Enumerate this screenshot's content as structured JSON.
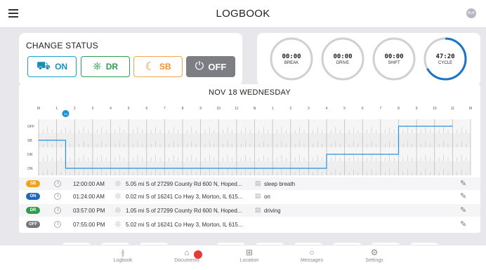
{
  "app": {
    "title": "LOGBOOK",
    "avatar_initials": "BLB"
  },
  "change_status": {
    "heading": "CHANGE STATUS",
    "buttons": [
      {
        "label": "ON",
        "icon": "truck-icon"
      },
      {
        "label": "DR",
        "icon": "steering-wheel-icon"
      },
      {
        "label": "SB",
        "icon": "sleep-icon"
      },
      {
        "label": "OFF",
        "icon": "power-icon",
        "active": true
      }
    ]
  },
  "timers": [
    {
      "value": "00:00",
      "label": "BREAK",
      "progress": 0
    },
    {
      "value": "00:00",
      "label": "DRIVE",
      "progress": 0
    },
    {
      "value": "00:00",
      "label": "SHIFT",
      "progress": 0
    },
    {
      "value": "47:20",
      "label": "CYCLE",
      "progress": 0.67
    }
  ],
  "log": {
    "date": "NOV 18 WEDNESDAY",
    "current_hour_marker": "14",
    "hour_labels": [
      "M",
      "1",
      "2",
      "3",
      "4",
      "5",
      "6",
      "7",
      "8",
      "9",
      "10",
      "11",
      "N",
      "1",
      "2",
      "3",
      "4",
      "5",
      "6",
      "7",
      "8",
      "9",
      "10",
      "11",
      "M"
    ],
    "status_rows": [
      "OFF",
      "SB",
      "DR",
      "ON"
    ],
    "graph_segments": [
      {
        "status": "SB",
        "from_hour": 0,
        "to_hour": 1.5
      },
      {
        "status": "ON",
        "from_hour": 1.5,
        "to_hour": 16.0
      },
      {
        "status": "DR",
        "from_hour": 16.0,
        "to_hour": 20.0
      },
      {
        "status": "OFF",
        "from_hour": 20.0,
        "to_hour": 23.0
      }
    ],
    "entries": [
      {
        "status": "SB",
        "color": "#f0a21a",
        "time": "12:00:00 AM",
        "location": "5.05 mi S of 27299 County Rd 600 N, Hoped...",
        "note": "sleep breath"
      },
      {
        "status": "ON",
        "color": "#1769c4",
        "time": "01:24:00 AM",
        "location": "0.02 mi S of 16241 Co Hwy 3, Morton, IL 615...",
        "note": "on"
      },
      {
        "status": "DR",
        "color": "#2e9e4e",
        "time": "03:57:00 PM",
        "location": "1.05 mi S of 27299 County Rd 600 N, Hoped...",
        "note": "driving"
      },
      {
        "status": "OFF",
        "color": "#75757c",
        "time": "07:55:00 PM",
        "location": "5.02 mi S of 16241 Co Hwy 3, Morton, IL 615...",
        "note": ""
      }
    ]
  },
  "nav": {
    "tabs": [
      {
        "label": "Logbook",
        "icon": "sliders-icon"
      },
      {
        "label": "Documents",
        "icon": "inbox-icon"
      },
      {
        "label": "Location",
        "icon": "map-icon"
      },
      {
        "label": "Messages",
        "icon": "chat-icon"
      },
      {
        "label": "Settings",
        "icon": "gear-icon"
      }
    ]
  },
  "colors": {
    "accent": "#1a8fd6",
    "graph_line": "#2a8fd6"
  }
}
